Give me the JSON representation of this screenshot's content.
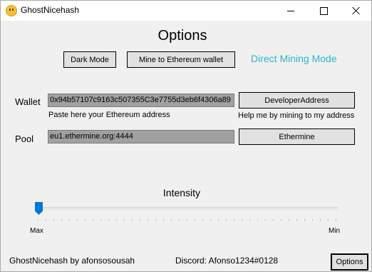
{
  "window": {
    "title": "GhostNicehash"
  },
  "header": {
    "title": "Options"
  },
  "toolbar": {
    "dark_mode_label": "Dark Mode",
    "mine_eth_label": "Mine to Ethereum wallet",
    "mode_label": "Direct Mining Mode",
    "mode_color": "#28b9c2"
  },
  "wallet": {
    "label": "Wallet",
    "value": "0x94b57107c9163c507355C3e7755d3eb6f4306a89",
    "hint": "Paste here your Ethereum address",
    "dev_button": "DeveloperAddress",
    "dev_hint": "Help me by mining to my address"
  },
  "pool": {
    "label": "Pool",
    "value": "eu1.ethermine.org:4444",
    "button": "Ethermine"
  },
  "intensity": {
    "label": "Intensity",
    "left_label": "Max",
    "right_label": "Min",
    "level": 0,
    "accent": "#0078d7"
  },
  "footer": {
    "credit": "GhostNicehash by afonsosousah",
    "discord": "Discord: Afonso1234#0128",
    "options_button": "Options"
  }
}
